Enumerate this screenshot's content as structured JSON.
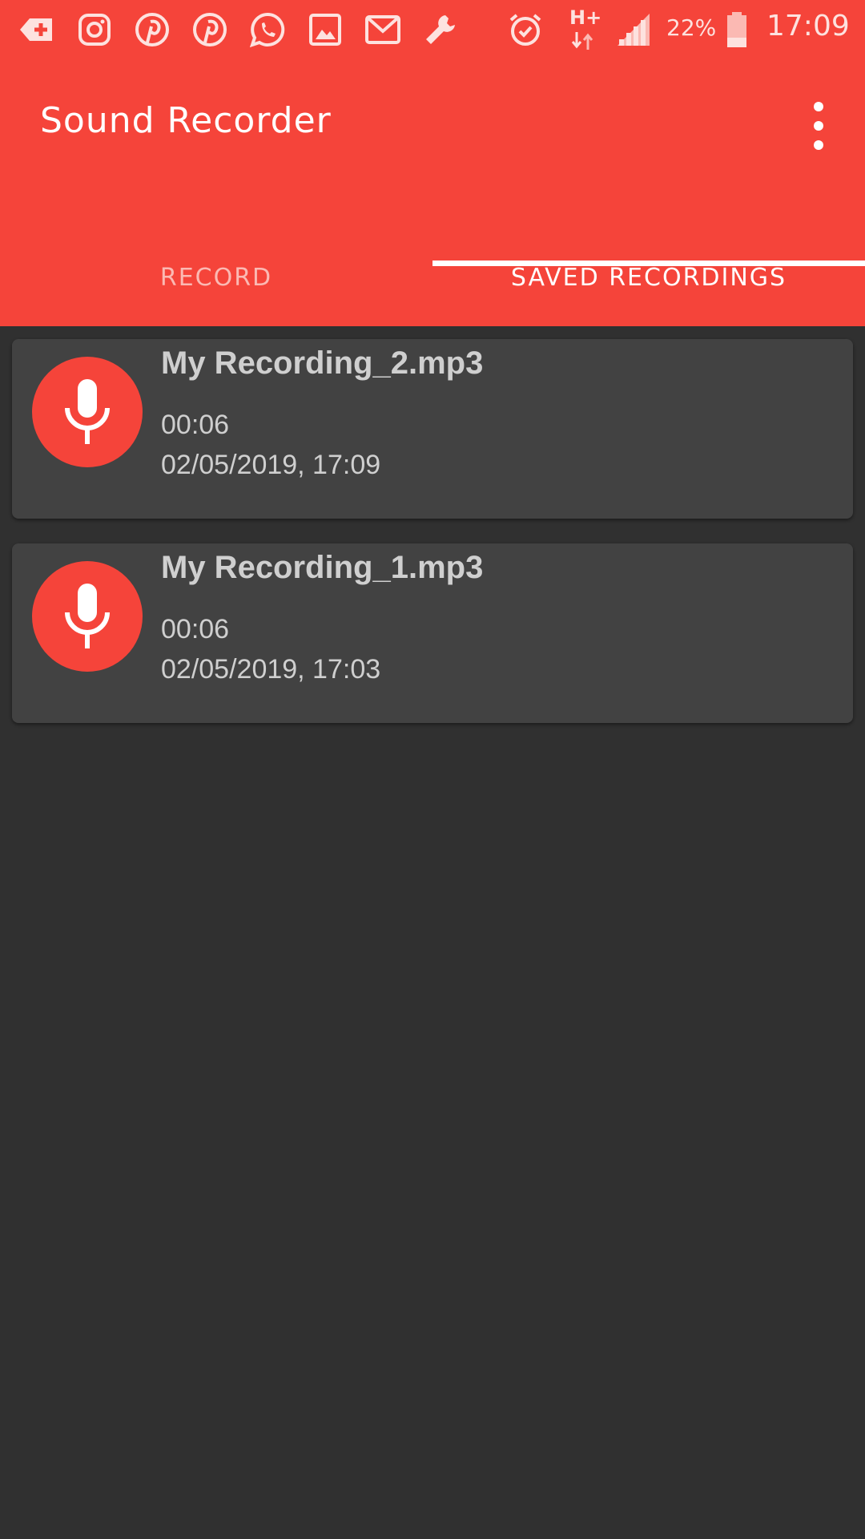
{
  "status_bar": {
    "battery_percent": "22%",
    "time": "17:09",
    "network": "H+",
    "icons": [
      "add-tag-icon",
      "instagram-icon",
      "pinterest-icon",
      "pinterest-icon",
      "whatsapp-icon",
      "gallery-icon",
      "gmail-icon",
      "wrench-icon",
      "alarm-icon",
      "network-type-icon",
      "signal-icon",
      "battery-icon"
    ]
  },
  "app": {
    "title": "Sound Recorder",
    "accent_color": "#f5443a",
    "background_color": "#303030",
    "card_color": "#424242"
  },
  "tabs": [
    {
      "label": "RECORD",
      "active": false
    },
    {
      "label": "SAVED RECORDINGS",
      "active": true
    }
  ],
  "recordings": [
    {
      "name": "My Recording_2.mp3",
      "duration": "00:06",
      "date": "02/05/2019, 17:09"
    },
    {
      "name": "My Recording_1.mp3",
      "duration": "00:06",
      "date": "02/05/2019, 17:03"
    }
  ]
}
